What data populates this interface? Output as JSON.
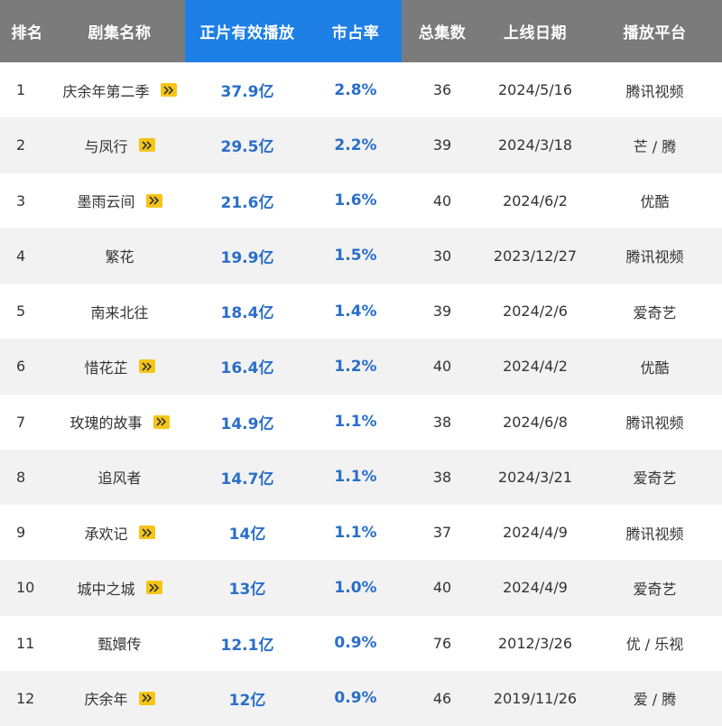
{
  "table": {
    "headers": [
      "排名",
      "剧集名称",
      "正片有效播放",
      "市占率",
      "总集数",
      "上线日期",
      "播放平台"
    ],
    "highlight_color": "#1e7fe6",
    "header_bg": "#7b7b7b",
    "rows": [
      {
        "rank": "1",
        "title": "庆余年第二季",
        "badge": true,
        "plays": "37.9亿",
        "share": "2.8%",
        "episodes": "36",
        "date": "2024/5/16",
        "platform": "腾讯视频"
      },
      {
        "rank": "2",
        "title": "与凤行",
        "badge": true,
        "plays": "29.5亿",
        "share": "2.2%",
        "episodes": "39",
        "date": "2024/3/18",
        "platform": "芒 / 腾"
      },
      {
        "rank": "3",
        "title": "墨雨云间",
        "badge": true,
        "plays": "21.6亿",
        "share": "1.6%",
        "episodes": "40",
        "date": "2024/6/2",
        "platform": "优酷"
      },
      {
        "rank": "4",
        "title": "繁花",
        "badge": false,
        "plays": "19.9亿",
        "share": "1.5%",
        "episodes": "30",
        "date": "2023/12/27",
        "platform": "腾讯视频"
      },
      {
        "rank": "5",
        "title": "南来北往",
        "badge": false,
        "plays": "18.4亿",
        "share": "1.4%",
        "episodes": "39",
        "date": "2024/2/6",
        "platform": "爱奇艺"
      },
      {
        "rank": "6",
        "title": "惜花芷",
        "badge": true,
        "plays": "16.4亿",
        "share": "1.2%",
        "episodes": "40",
        "date": "2024/4/2",
        "platform": "优酷"
      },
      {
        "rank": "7",
        "title": "玫瑰的故事",
        "badge": true,
        "plays": "14.9亿",
        "share": "1.1%",
        "episodes": "38",
        "date": "2024/6/8",
        "platform": "腾讯视频"
      },
      {
        "rank": "8",
        "title": "追风者",
        "badge": false,
        "plays": "14.7亿",
        "share": "1.1%",
        "episodes": "38",
        "date": "2024/3/21",
        "platform": "爱奇艺"
      },
      {
        "rank": "9",
        "title": "承欢记",
        "badge": true,
        "plays": "14亿",
        "share": "1.1%",
        "episodes": "37",
        "date": "2024/4/9",
        "platform": "腾讯视频"
      },
      {
        "rank": "10",
        "title": "城中之城",
        "badge": true,
        "plays": "13亿",
        "share": "1.0%",
        "episodes": "40",
        "date": "2024/4/9",
        "platform": "爱奇艺"
      },
      {
        "rank": "11",
        "title": "甄嬛传",
        "badge": false,
        "plays": "12.1亿",
        "share": "0.9%",
        "episodes": "76",
        "date": "2012/3/26",
        "platform": "优 / 乐视"
      },
      {
        "rank": "12",
        "title": "庆余年",
        "badge": true,
        "plays": "12亿",
        "share": "0.9%",
        "episodes": "46",
        "date": "2019/11/26",
        "platform": "爱 / 腾"
      }
    ]
  }
}
